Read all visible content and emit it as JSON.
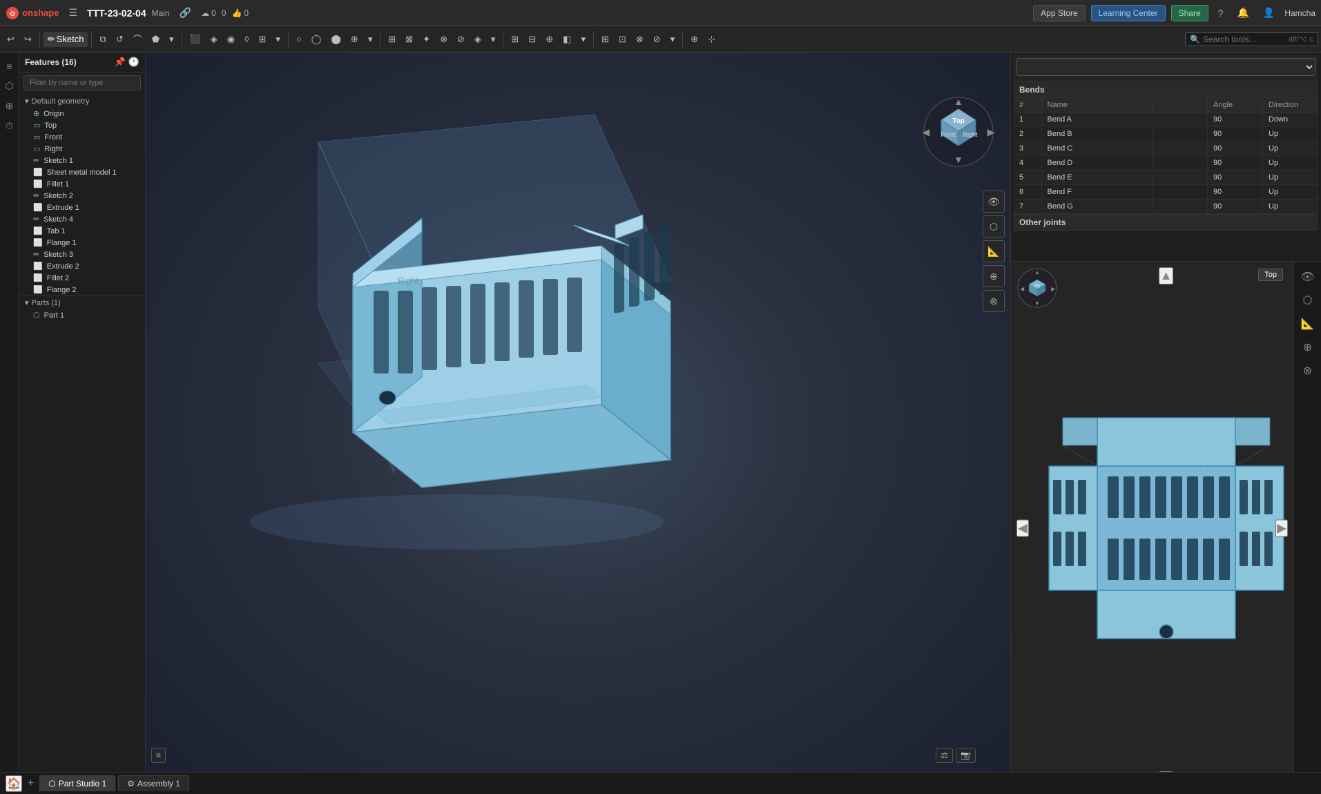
{
  "topbar": {
    "logo_text": "onshape",
    "hamburger": "☰",
    "doc_title": "TTT-23-02-04",
    "doc_branch": "Main",
    "link_icon": "🔗",
    "cloud_icon": "☁",
    "cloud_count": "0",
    "like_count": "0",
    "comment_count": "0",
    "app_store_label": "App Store",
    "learning_center_label": "Learning Center",
    "share_label": "Share",
    "help_icon": "?",
    "user_icon": "👤",
    "user_name": "Hamcha"
  },
  "toolbar": {
    "sketch_label": "Sketch",
    "search_placeholder": "Search tools...",
    "shortcut_hint": "alt/⌥ c"
  },
  "sidebar": {
    "title": "Features (16)",
    "filter_placeholder": "Filter by name or type",
    "default_geometry_label": "Default geometry",
    "origin_label": "Origin",
    "top_label": "Top",
    "front_label": "Front",
    "right_label": "Right",
    "sketch1_label": "Sketch 1",
    "sheet_metal_model1_label": "Sheet metal model 1",
    "fillet1_label": "Fillet 1",
    "sketch2_label": "Sketch 2",
    "extrude1_label": "Extrude 1",
    "sketch4_label": "Sketch 4",
    "tab1_label": "Tab 1",
    "flange1_label": "Flange 1",
    "sketch3_label": "Sketch 3",
    "extrude2_label": "Extrude 2",
    "fillet2_label": "Fillet 2",
    "flange2_label": "Flange 2",
    "parts_label": "Parts (1)",
    "part1_label": "Part 1"
  },
  "bends_table": {
    "dropdown_value": "",
    "section_label": "Bends",
    "col_num": "#",
    "col_name": "Name",
    "col_col2": "",
    "col_angle": "Angle",
    "col_direction": "Direction",
    "rows": [
      {
        "num": "1",
        "name": "Bend A",
        "angle": "90",
        "direction": "Down"
      },
      {
        "num": "2",
        "name": "Bend B",
        "angle": "90",
        "direction": "Up"
      },
      {
        "num": "3",
        "name": "Bend C",
        "angle": "90",
        "direction": "Up"
      },
      {
        "num": "4",
        "name": "Bend D",
        "angle": "90",
        "direction": "Up"
      },
      {
        "num": "5",
        "name": "Bend E",
        "angle": "90",
        "direction": "Up"
      },
      {
        "num": "6",
        "name": "Bend F",
        "angle": "90",
        "direction": "Up"
      },
      {
        "num": "7",
        "name": "Bend G",
        "angle": "90",
        "direction": "Up"
      }
    ],
    "other_joints_label": "Other joints"
  },
  "viewport": {
    "right_label": "Right",
    "top_label": "Top",
    "front_label": "Front"
  },
  "flat_pattern": {
    "top_label": "Top"
  },
  "bottom_tabs": [
    {
      "label": "Part Studio 1",
      "icon": "⬡",
      "active": true
    },
    {
      "label": "Assembly 1",
      "icon": "⚙",
      "active": false
    }
  ]
}
